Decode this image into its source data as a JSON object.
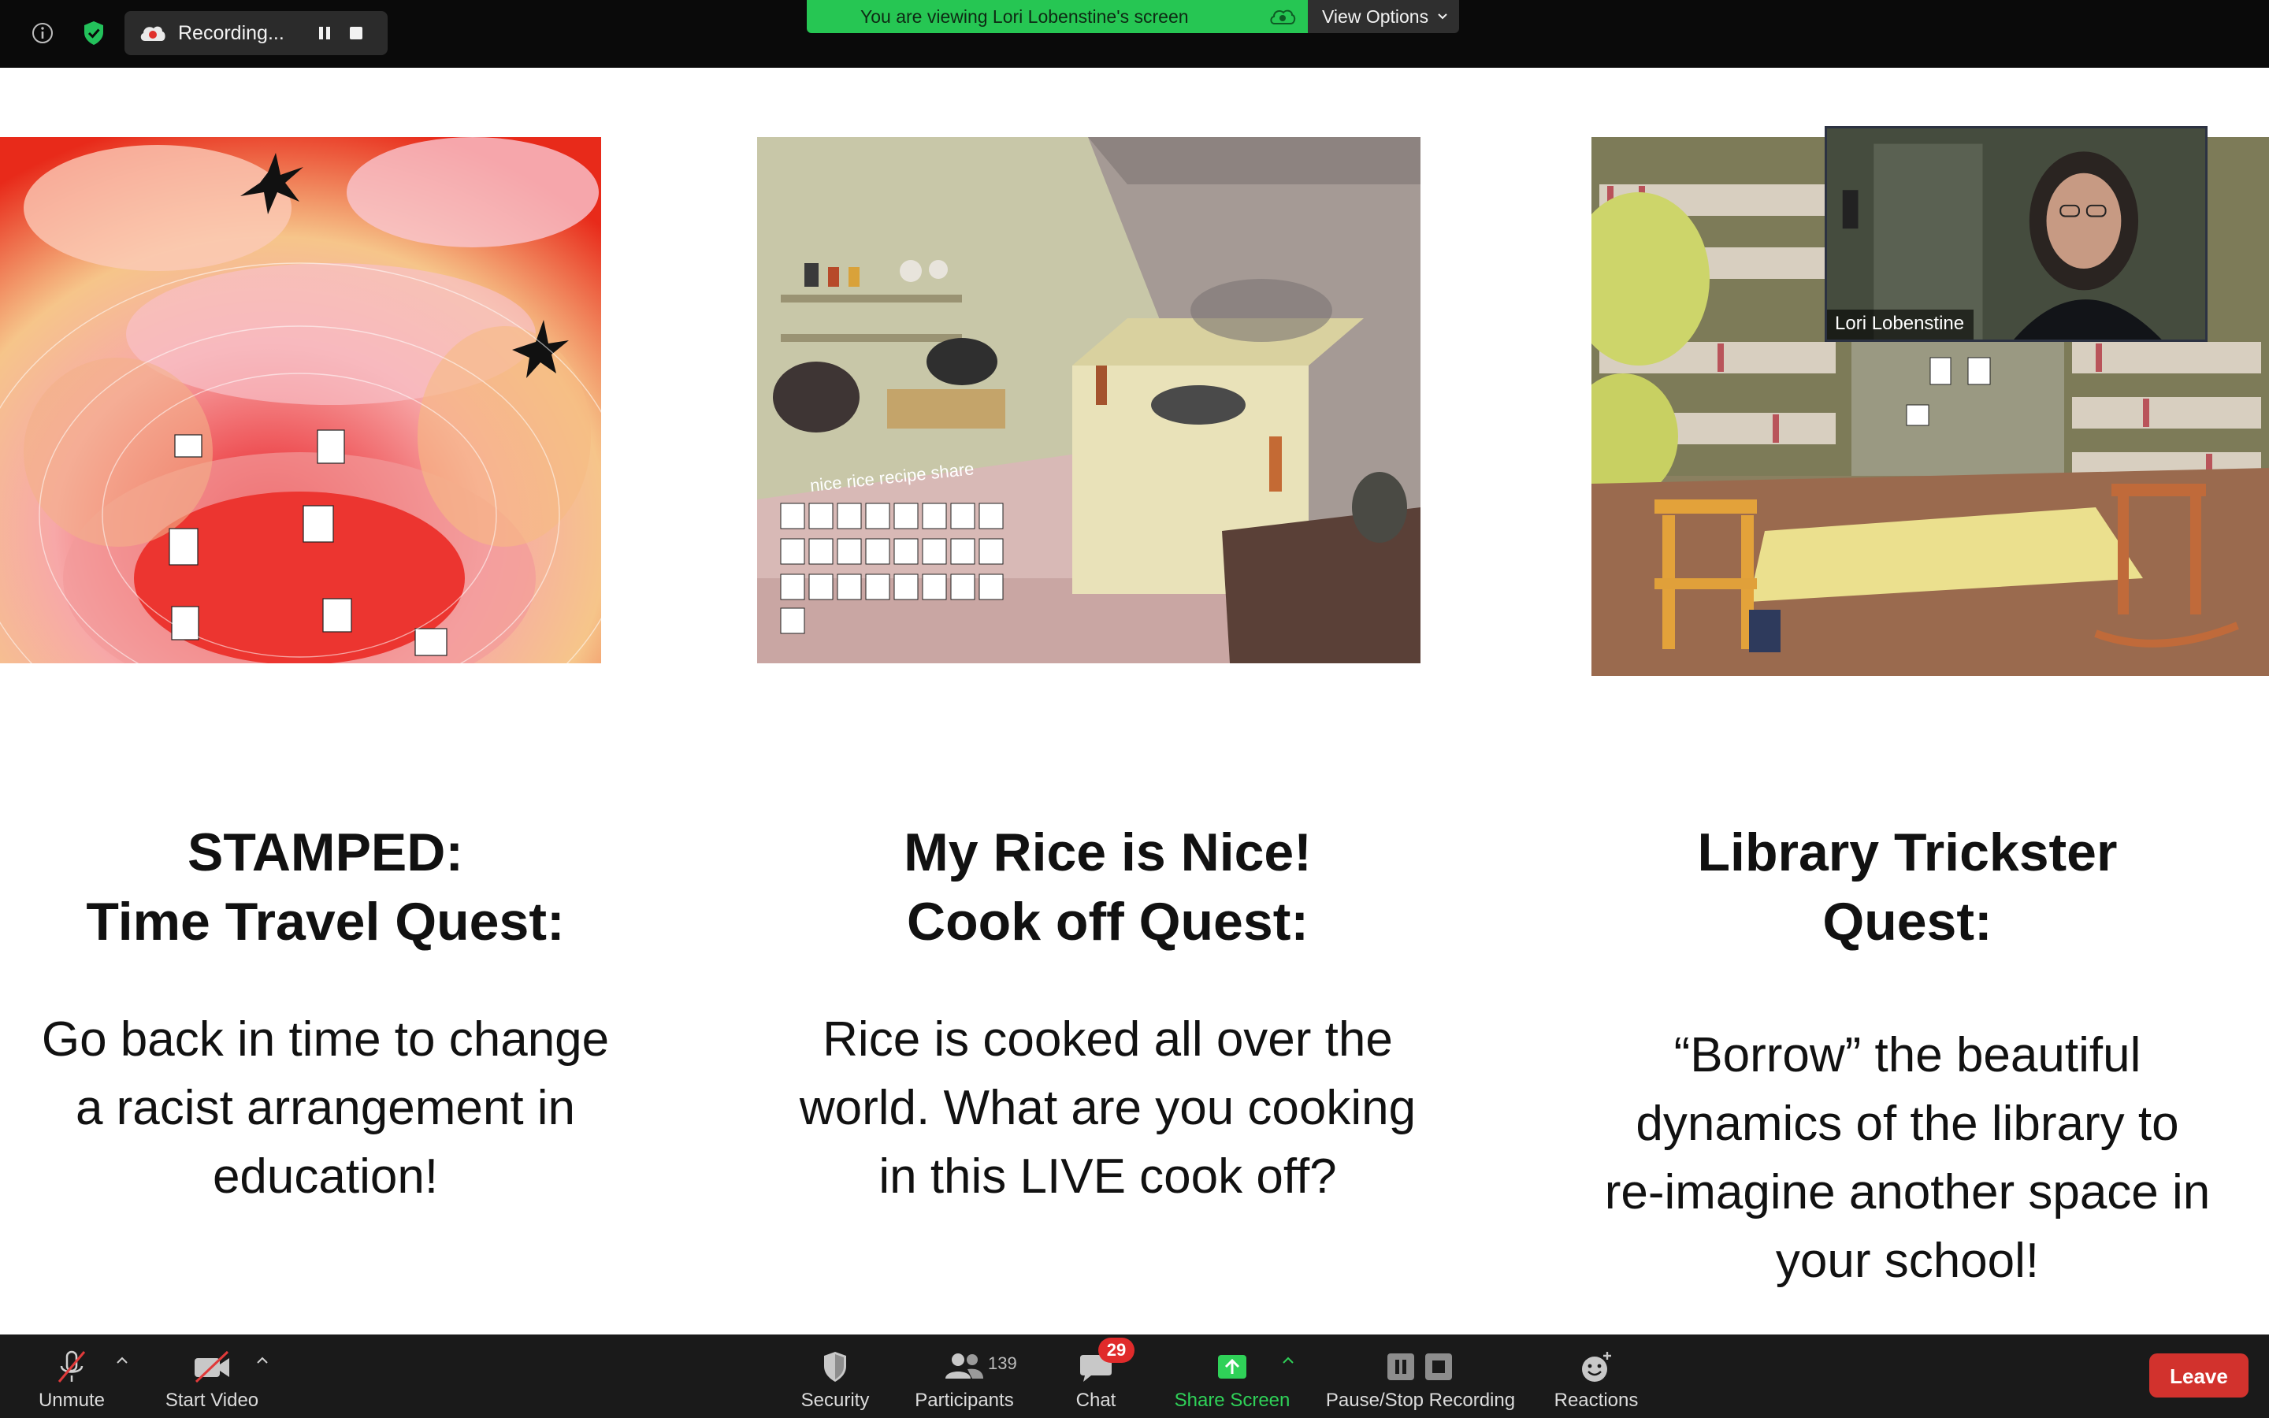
{
  "top_bar": {
    "recording_label": "Recording...",
    "viewing_banner": "You are viewing Lori Lobenstine's screen",
    "view_options_label": "View Options"
  },
  "shared_screen": {
    "quests": [
      {
        "title_lines": [
          "STAMPED:",
          "Time Travel Quest:"
        ],
        "body_lines": [
          "Go back in time to change",
          "a racist arrangement in",
          "education!"
        ]
      },
      {
        "title_lines": [
          "My Rice is Nice!",
          "Cook off Quest:"
        ],
        "body_lines": [
          "Rice is cooked all over the",
          "world. What are you cooking",
          "in this LIVE cook off?"
        ],
        "image_caption": "nice rice recipe share"
      },
      {
        "title_lines": [
          "Library Trickster",
          "Quest:"
        ],
        "body_lines": [
          "“Borrow” the beautiful",
          "dynamics of the library to",
          "re-imagine another space in",
          "your school!"
        ]
      }
    ]
  },
  "speaker": {
    "name": "Lori Lobenstine"
  },
  "toolbar": {
    "unmute_label": "Unmute",
    "start_video_label": "Start Video",
    "security_label": "Security",
    "participants_label": "Participants",
    "participants_count": "139",
    "chat_label": "Chat",
    "chat_badge": "29",
    "share_label": "Share Screen",
    "record_label": "Pause/Stop Recording",
    "reactions_label": "Reactions",
    "leave_label": "Leave"
  },
  "colors": {
    "share_green": "#2fd158",
    "leave_red": "#d2322d",
    "banner_green": "#26c653",
    "badge_red": "#e02b2b"
  },
  "icons": [
    "info-icon",
    "shield-check-icon",
    "recording-cloud-icon",
    "pause-icon",
    "stop-icon",
    "cloud-icon",
    "chevron-down-icon",
    "microphone-muted-icon",
    "video-off-icon",
    "caret-up-icon",
    "security-shield-icon",
    "participants-icon",
    "chat-bubble-icon",
    "share-screen-arrow-icon",
    "pause-stop-recording-icon",
    "reactions-icon"
  ]
}
